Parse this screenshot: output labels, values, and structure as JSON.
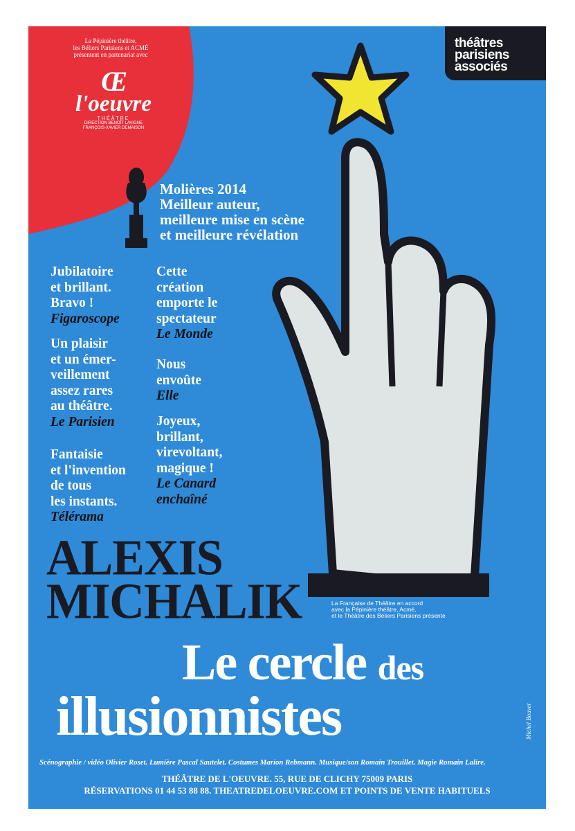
{
  "colors": {
    "background": "#2f8ad8",
    "red": "#e8303a",
    "star": "#f2e532",
    "hand": "#dfe5e5",
    "ink": "#1a1a22"
  },
  "intro": [
    "La Pépinière théâtre,",
    "les Béliers Parisiens et ACMÉ",
    "présentent en partenariat avec"
  ],
  "oeuvre_logo": {
    "mark": "Œ",
    "name": "l'oeuvre",
    "sub": "THÉÂTRE",
    "direction": [
      "DIRECTION BENOÎT LAVIGNE",
      "FRANÇOIS-XAVIER DEMAISON"
    ]
  },
  "tpa_logo": [
    "théâtres",
    "parisiens",
    "associés"
  ],
  "moliere": [
    "Molières 2014",
    "Meilleur auteur,",
    "meilleure mise en scène",
    "et meilleure révélation"
  ],
  "quotes_left": [
    {
      "lines": [
        "Jubilatoire",
        "et brillant.",
        "Bravo !"
      ],
      "source": "Figaroscope"
    },
    {
      "lines": [
        "Un plaisir",
        "et un émer-",
        "veillement",
        "assez rares",
        "au théâtre."
      ],
      "source": "Le Parisien"
    },
    {
      "lines": [
        "Fantaisie",
        "et l'invention",
        "de tous",
        "les instants."
      ],
      "source": "Télérama"
    }
  ],
  "quotes_right": [
    {
      "lines": [
        "Cette",
        "création",
        "emporte le",
        "spectateur"
      ],
      "source": "Le Monde"
    },
    {
      "lines": [
        "Nous",
        "envoûte"
      ],
      "source": "Elle"
    },
    {
      "lines": [
        " Joyeux,",
        "brillant,",
        "virevoltant,",
        "magique !"
      ],
      "source_lines": [
        "Le Canard",
        "enchaîné"
      ]
    }
  ],
  "author": [
    "ALEXIS",
    "MICHALIK"
  ],
  "presenters": [
    "La Française de Théâtre en accord",
    "avec la Pépinière théâtre, Acmé,",
    "et le Théâtre des Béliers Parisiens présente"
  ],
  "title": {
    "line1": "Le cercle",
    "line1_small": "des",
    "line2": "illusionnistes"
  },
  "credits": "Scénographie / vidéo Olivier Roset. Lumière Pascal Sautelet. Costumes Marion Rebmann. Musique/son Romain Trouillet. Magie Romain Lalire.",
  "venue": [
    "THÉÂTRE DE L'OEUVRE. 55, RUE DE CLICHY 75009 PARIS",
    "RÉSERVATIONS 01 44 53 88 88. THEATREDELOEUVRE.COM ET POINTS DE VENTE HABITUELS"
  ],
  "signature": "Michel Bouvet"
}
